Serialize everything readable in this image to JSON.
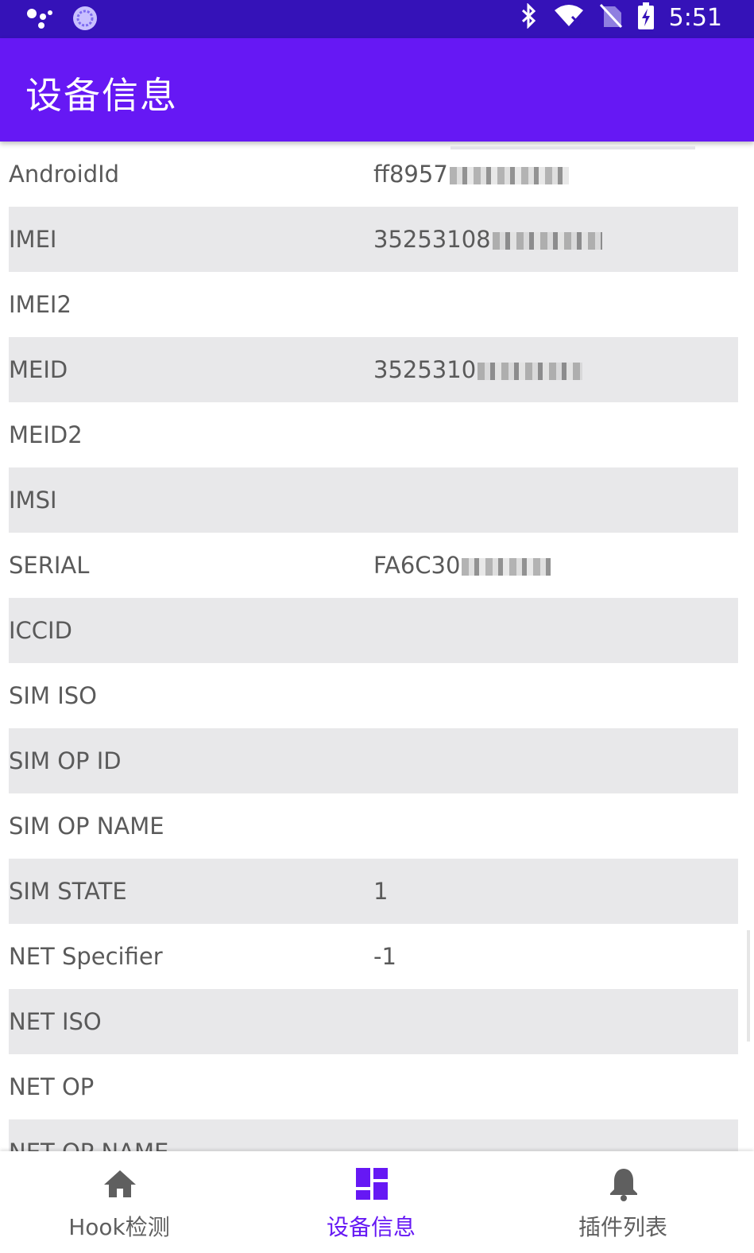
{
  "status_bar": {
    "time": "5:51",
    "icons": [
      "assistant-dots-icon",
      "sync-circle-icon",
      "bluetooth-icon",
      "wifi-off-icon",
      "no-sim-icon",
      "battery-charging-icon"
    ]
  },
  "app_bar": {
    "title": "设备信息"
  },
  "colors": {
    "status_bar": "#3512b8",
    "app_bar": "#6618f4",
    "active_nav": "#6618f4",
    "row_alt": "#e8e8ea"
  },
  "rows": [
    {
      "key": "AndroidId",
      "value": "ff8957"
    },
    {
      "key": "IMEI",
      "value": "35253108"
    },
    {
      "key": "IMEI2",
      "value": ""
    },
    {
      "key": "MEID",
      "value": "3525310"
    },
    {
      "key": "MEID2",
      "value": ""
    },
    {
      "key": "IMSI",
      "value": ""
    },
    {
      "key": "SERIAL",
      "value": "FA6C30"
    },
    {
      "key": "ICCID",
      "value": ""
    },
    {
      "key": "SIM ISO",
      "value": ""
    },
    {
      "key": "SIM OP ID",
      "value": ""
    },
    {
      "key": "SIM OP NAME",
      "value": ""
    },
    {
      "key": "SIM STATE",
      "value": "1"
    },
    {
      "key": "NET Specifier",
      "value": "-1"
    },
    {
      "key": "NET ISO",
      "value": ""
    },
    {
      "key": "NET OP",
      "value": ""
    },
    {
      "key": "NET OP NAME",
      "value": ""
    }
  ],
  "bottom_nav": [
    {
      "label": "Hook检测",
      "icon": "home-icon",
      "active": false
    },
    {
      "label": "设备信息",
      "icon": "dashboard-icon",
      "active": true
    },
    {
      "label": "插件列表",
      "icon": "bell-icon",
      "active": false
    }
  ]
}
